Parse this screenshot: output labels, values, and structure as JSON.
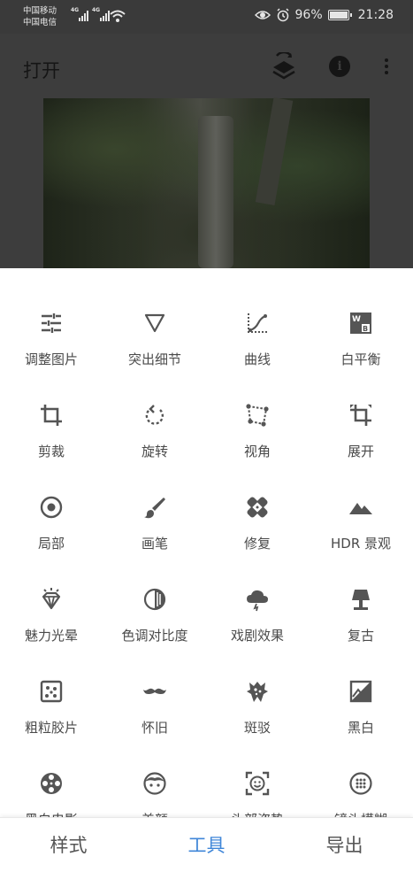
{
  "status_bar": {
    "carrier1": "中国移动",
    "carrier2": "中国电信",
    "net1": "4G",
    "net2": "4G",
    "battery": "96%",
    "time": "21:28"
  },
  "app_bar": {
    "title": "打开"
  },
  "tools": [
    {
      "label": "调整图片",
      "icon": "tune-icon"
    },
    {
      "label": "突出细节",
      "icon": "details-triangle-icon"
    },
    {
      "label": "曲线",
      "icon": "curves-icon"
    },
    {
      "label": "白平衡",
      "icon": "white-balance-icon"
    },
    {
      "label": "剪裁",
      "icon": "crop-icon"
    },
    {
      "label": "旋转",
      "icon": "rotate-icon"
    },
    {
      "label": "视角",
      "icon": "perspective-icon"
    },
    {
      "label": "展开",
      "icon": "expand-icon"
    },
    {
      "label": "局部",
      "icon": "selective-icon"
    },
    {
      "label": "画笔",
      "icon": "brush-icon"
    },
    {
      "label": "修复",
      "icon": "healing-icon"
    },
    {
      "label": "HDR 景观",
      "icon": "hdr-mountain-icon"
    },
    {
      "label": "魅力光晕",
      "icon": "glamour-glow-icon"
    },
    {
      "label": "色调对比度",
      "icon": "tonal-contrast-icon"
    },
    {
      "label": "戏剧效果",
      "icon": "drama-cloud-icon"
    },
    {
      "label": "复古",
      "icon": "vintage-lamp-icon"
    },
    {
      "label": "粗粒胶片",
      "icon": "grainy-film-icon"
    },
    {
      "label": "怀旧",
      "icon": "retrolux-mustache-icon"
    },
    {
      "label": "斑驳",
      "icon": "grunge-icon"
    },
    {
      "label": "黑白",
      "icon": "black-white-icon"
    },
    {
      "label": "黑白电影",
      "icon": "noir-film-reel-icon"
    },
    {
      "label": "美颜",
      "icon": "face-enhance-icon"
    },
    {
      "label": "头部姿势",
      "icon": "head-pose-icon"
    },
    {
      "label": "镜头模糊",
      "icon": "lens-blur-icon"
    }
  ],
  "bottom_nav": {
    "tabs": [
      {
        "label": "样式",
        "active": false
      },
      {
        "label": "工具",
        "active": true
      },
      {
        "label": "导出",
        "active": false
      }
    ]
  },
  "colors": {
    "accent": "#3f86d8",
    "icon": "#555555",
    "label": "#4a4a4a"
  }
}
